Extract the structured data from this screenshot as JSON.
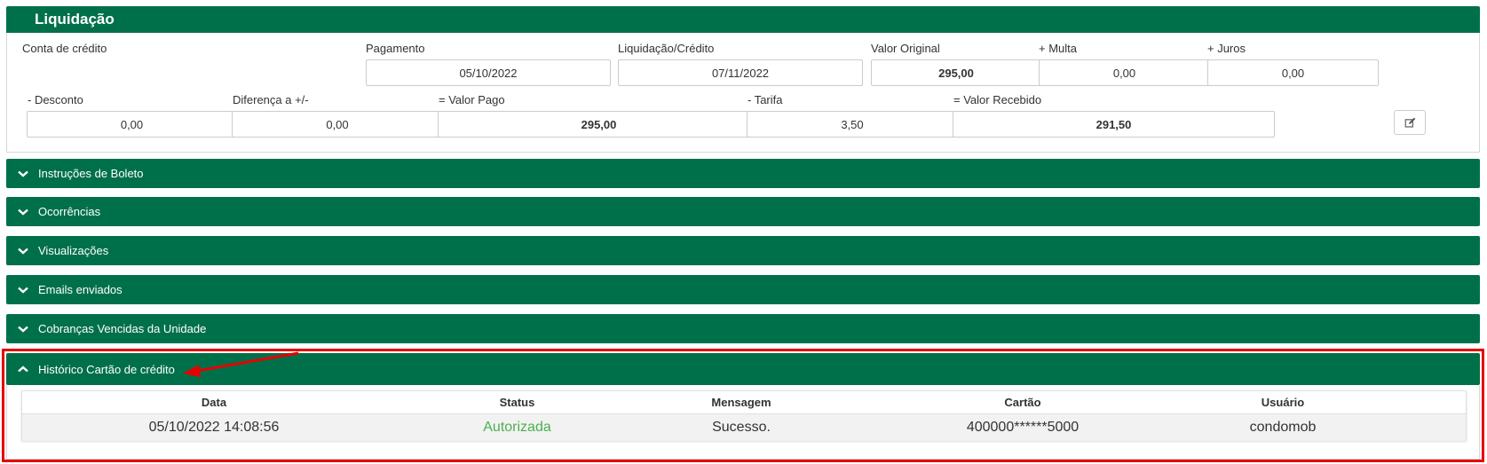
{
  "liquidacao": {
    "title": "Liquidação",
    "conta_credito_label": "Conta de crédito",
    "pagamento": {
      "label": "Pagamento",
      "value": "05/10/2022"
    },
    "liquidacao_credito": {
      "label": "Liquidação/Crédito",
      "value": "07/11/2022"
    },
    "valor_original": {
      "label": "Valor Original",
      "value": "295,00"
    },
    "multa": {
      "label": "+ Multa",
      "value": "0,00"
    },
    "juros": {
      "label": "+ Juros",
      "value": "0,00"
    },
    "desconto": {
      "label": "- Desconto",
      "value": "0,00"
    },
    "diferenca": {
      "label": "Diferença a +/-",
      "value": "0,00"
    },
    "valor_pago": {
      "label": "= Valor Pago",
      "value": "295,00"
    },
    "tarifa": {
      "label": "- Tarifa",
      "value": "3,50"
    },
    "valor_recebido": {
      "label": "= Valor Recebido",
      "value": "291,50"
    },
    "edit_icon": "edit-icon"
  },
  "accordions": [
    {
      "label": "Instruções de Boleto",
      "icon": "chevron-down-icon"
    },
    {
      "label": "Ocorrências",
      "icon": "chevron-down-icon"
    },
    {
      "label": "Visualizações",
      "icon": "chevron-down-icon"
    },
    {
      "label": "Emails enviados",
      "icon": "chevron-down-icon"
    },
    {
      "label": "Cobranças Vencidas da Unidade",
      "icon": "chevron-down-icon"
    }
  ],
  "historico": {
    "label": "Histórico Cartão de crédito",
    "icon": "chevron-up-icon",
    "columns": [
      "Data",
      "Status",
      "Mensagem",
      "Cartão",
      "Usuário"
    ],
    "rows": [
      {
        "data": "05/10/2022 14:08:56",
        "status": "Autorizada",
        "mensagem": "Sucesso.",
        "cartao": "400000******5000",
        "usuario": "condomob"
      }
    ]
  },
  "colors": {
    "header_green": "#00704a",
    "status_authorized": "#4caf50",
    "highlight_red": "#e60000"
  }
}
